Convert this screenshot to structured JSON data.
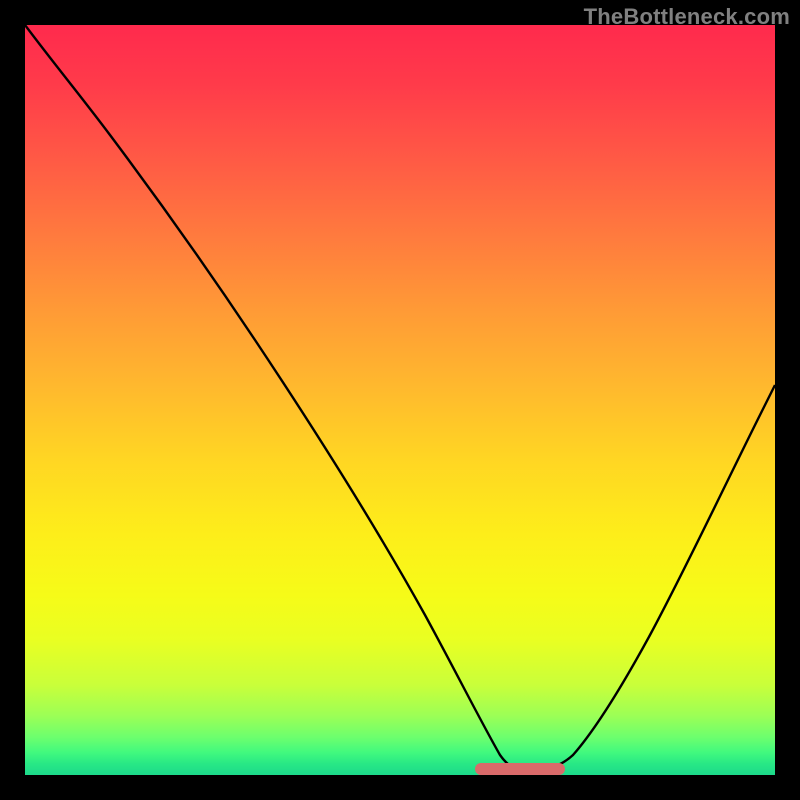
{
  "watermark": "TheBottleneck.com",
  "colors": {
    "background": "#000000",
    "watermark_text": "#808080",
    "curve_stroke": "#000000",
    "marker": "#d96a6a",
    "gradient_top": "#ff2a4d",
    "gradient_bottom": "#1dd98b"
  },
  "layout": {
    "image_size": 800,
    "plot_inset": 25,
    "plot_size": 750
  },
  "chart_data": {
    "type": "line",
    "title": "",
    "xlabel": "",
    "ylabel": "",
    "xlim": [
      0,
      100
    ],
    "ylim": [
      0,
      100
    ],
    "x": [
      0,
      5,
      10,
      15,
      20,
      25,
      30,
      35,
      40,
      45,
      50,
      55,
      60,
      63,
      66,
      69,
      72,
      76,
      80,
      85,
      90,
      95,
      100
    ],
    "values": [
      100,
      95,
      89,
      82,
      75,
      67,
      59,
      50,
      41,
      32,
      23,
      14,
      6,
      2,
      0.5,
      0.5,
      1,
      3,
      8,
      17,
      30,
      46,
      55
    ],
    "series": [
      {
        "name": "bottleneck-curve",
        "x": [
          0,
          5,
          10,
          15,
          20,
          25,
          30,
          35,
          40,
          45,
          50,
          55,
          60,
          63,
          66,
          69,
          72,
          76,
          80,
          85,
          90,
          95,
          100
        ],
        "values": [
          100,
          95,
          89,
          82,
          75,
          67,
          59,
          50,
          41,
          32,
          23,
          14,
          6,
          2,
          0.5,
          0.5,
          1,
          3,
          8,
          17,
          30,
          46,
          55
        ]
      }
    ],
    "highlight_range_x": [
      60,
      72
    ],
    "grid": false,
    "legend": false
  }
}
